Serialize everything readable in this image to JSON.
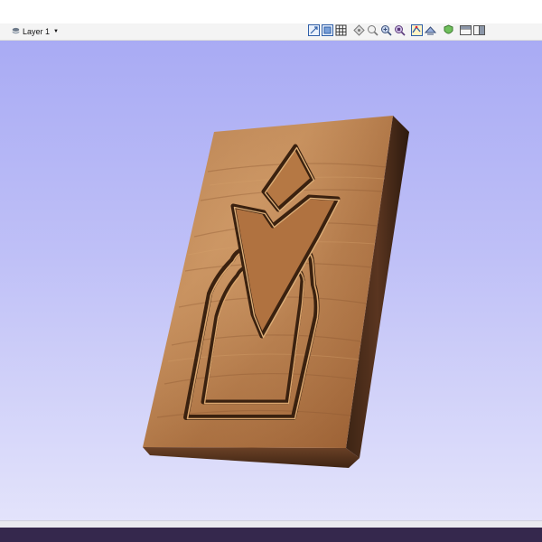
{
  "toolbar": {
    "layer_label": "Layer 1",
    "icons": [
      "view-top-icon",
      "view-iso-icon",
      "grid-icon",
      "center-view-icon",
      "zoom-fit-icon",
      "zoom-in-icon",
      "zoom-selected-icon",
      "show-toolpath-icon",
      "show-model-icon",
      "shaded-material-icon",
      "layout-horizontal-icon",
      "layout-vertical-icon"
    ]
  },
  "viewport": {
    "background_top": "#a9abf4",
    "background_bottom": "#e3e3fb",
    "model": "wooden-plaque-checkmark-carving",
    "material_color": "#a8693a"
  },
  "statusbar": {
    "color": "#35284d"
  }
}
